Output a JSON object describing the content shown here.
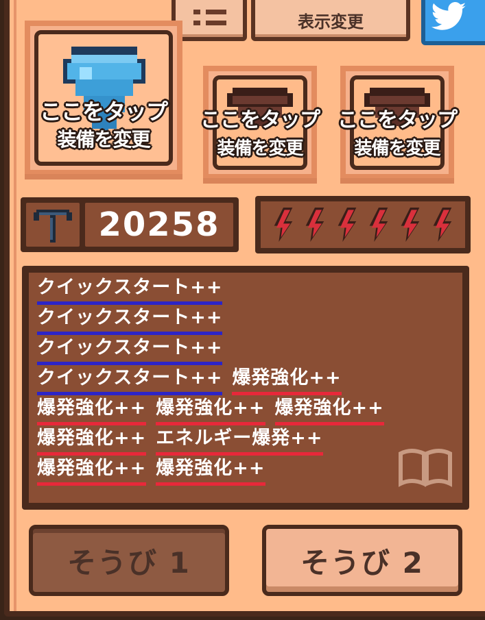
{
  "top_bar": {
    "menu_icon": "list-icon",
    "view_change_label": "表示変更",
    "share_icon": "twitter-bird-icon"
  },
  "equipment": {
    "slots": [
      {
        "line1": "ここをタップ",
        "line2": "装備を変更",
        "icon": "blue-drill-icon",
        "selected": true
      },
      {
        "line1": "ここをタップ",
        "line2": "装備を変更",
        "icon": "brown-drill-icon",
        "selected": false
      },
      {
        "line1": "ここをタップ",
        "line2": "装備を変更",
        "icon": "brown-drill-icon",
        "selected": false
      }
    ]
  },
  "stats": {
    "pickaxe_icon": "pickaxe-icon",
    "score": "20258",
    "energy_icon": "lightning-bolt-icon",
    "energy_count": 6
  },
  "skills": {
    "rows": [
      [
        {
          "text": "クイックスタート++",
          "color": "blue"
        }
      ],
      [
        {
          "text": "クイックスタート++",
          "color": "blue"
        }
      ],
      [
        {
          "text": "クイックスタート++",
          "color": "blue"
        }
      ],
      [
        {
          "text": "クイックスタート++",
          "color": "blue"
        },
        {
          "text": "爆発強化++",
          "color": "red"
        }
      ],
      [
        {
          "text": "爆発強化++",
          "color": "red"
        },
        {
          "text": "爆発強化++",
          "color": "red"
        },
        {
          "text": "爆発強化++",
          "color": "red"
        }
      ],
      [
        {
          "text": "爆発強化++",
          "color": "red"
        },
        {
          "text": "エネルギー爆発++",
          "color": "red"
        }
      ],
      [
        {
          "text": "爆発強化++",
          "color": "red"
        },
        {
          "text": "爆発強化++",
          "color": "red"
        }
      ]
    ],
    "book_icon": "book-icon"
  },
  "loadouts": {
    "button1": "そうび 1",
    "button2": "そうび 2",
    "active": 1
  },
  "colors": {
    "blue_underline": "#2c24c8",
    "red_underline": "#e8283a",
    "panel_bg": "#ffbb8a"
  }
}
